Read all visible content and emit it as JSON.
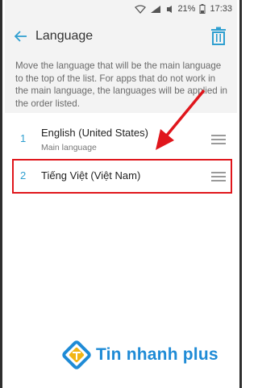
{
  "status": {
    "battery": "21%",
    "time": "17:33",
    "icons": [
      "wifi-icon",
      "signal-4g-icon",
      "mute-icon",
      "battery-icon"
    ]
  },
  "header": {
    "title": "Language",
    "back_icon": "back-arrow-icon",
    "delete_icon": "trash-icon"
  },
  "description": "Move the language that will be the main language to the top of the list. For apps that do not work in the main language, the languages will be applied in the order listed.",
  "languages": [
    {
      "index": "1",
      "name": "English (United States)",
      "subtitle": "Main language"
    },
    {
      "index": "2",
      "name": "Tiếng Việt (Việt Nam)",
      "subtitle": ""
    }
  ],
  "watermark": {
    "text": "Tin nhanh plus"
  },
  "colors": {
    "accent": "#2f9fd0",
    "highlight": "#e0161c",
    "brand": "#1f8bd6"
  }
}
